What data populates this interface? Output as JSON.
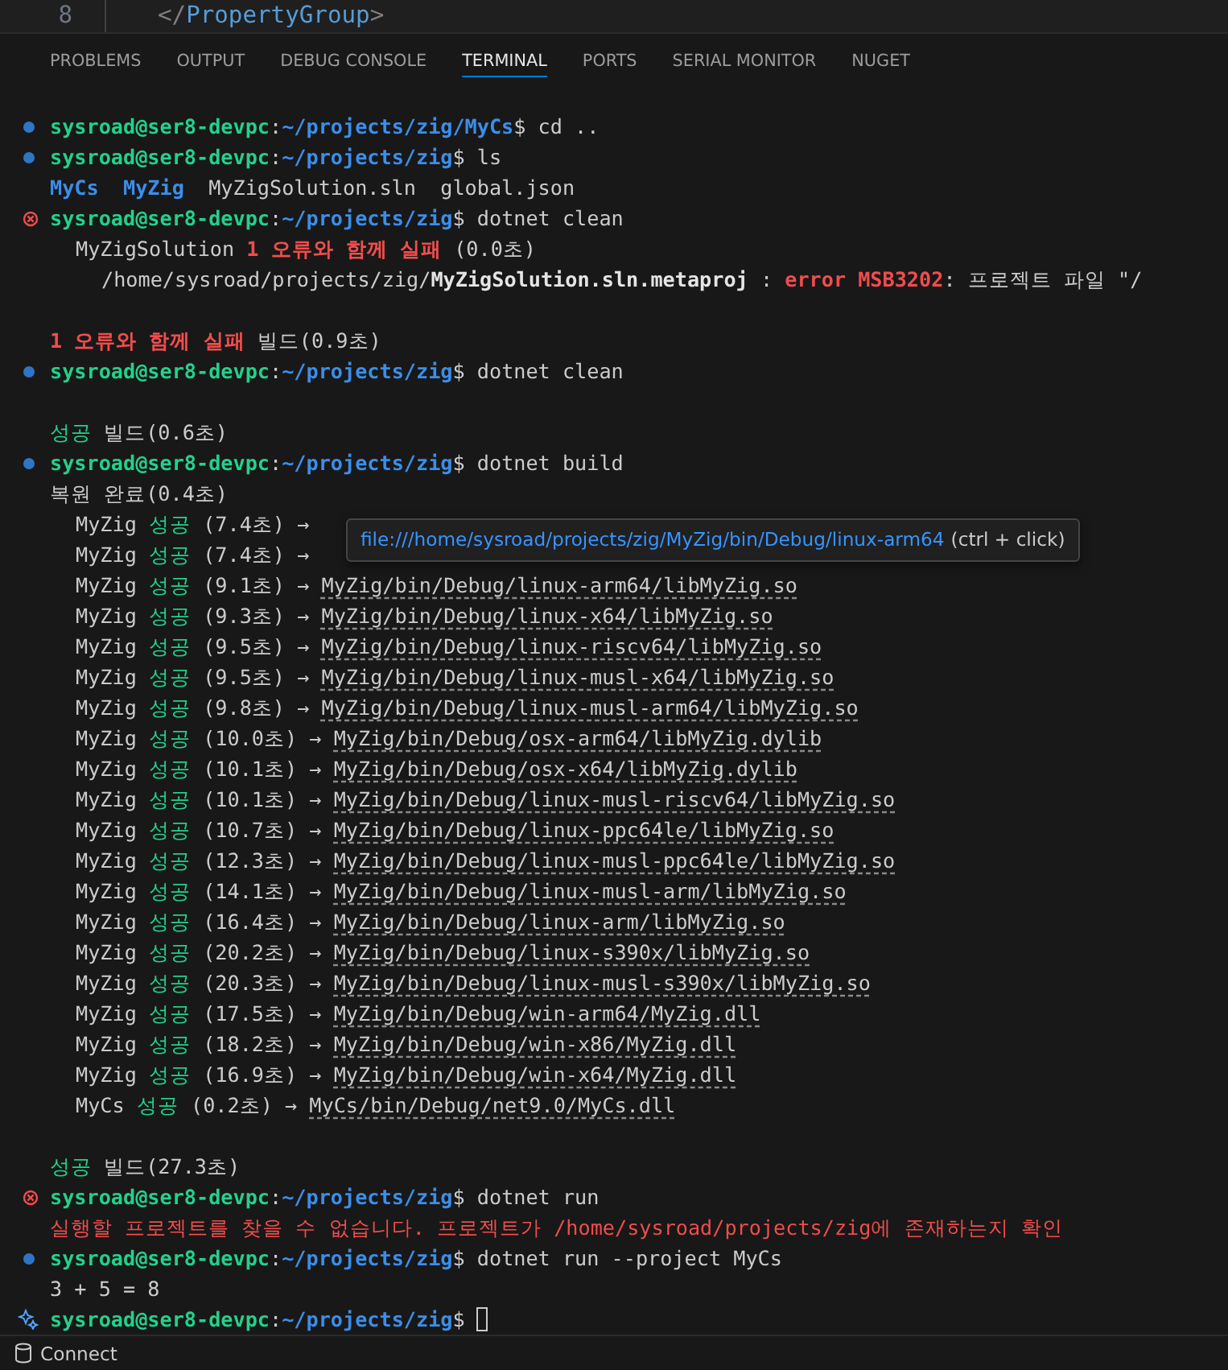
{
  "editor": {
    "line_number": "8",
    "code": [
      {
        "kind": "punct",
        "text": "</"
      },
      {
        "kind": "tag",
        "text": "PropertyGroup"
      },
      {
        "kind": "punct",
        "text": ">"
      }
    ]
  },
  "panel_tabs": [
    {
      "label": "PROBLEMS",
      "selected": false
    },
    {
      "label": "OUTPUT",
      "selected": false
    },
    {
      "label": "DEBUG CONSOLE",
      "selected": false
    },
    {
      "label": "TERMINAL",
      "selected": true
    },
    {
      "label": "PORTS",
      "selected": false
    },
    {
      "label": "SERIAL MONITOR",
      "selected": false
    },
    {
      "label": "NUGET",
      "selected": false
    }
  ],
  "terminal": {
    "lines": [
      {
        "kind": "prompt-success",
        "segments": [
          {
            "kind": "user",
            "text": "sysroad@ser8-devpc"
          },
          {
            "kind": "plain",
            "text": ":"
          },
          {
            "kind": "path",
            "text": "~/projects/zig/MyCs"
          },
          {
            "kind": "plain",
            "text": "$ cd .."
          }
        ]
      },
      {
        "kind": "prompt-success",
        "segments": [
          {
            "kind": "user",
            "text": "sysroad@ser8-devpc"
          },
          {
            "kind": "plain",
            "text": ":"
          },
          {
            "kind": "path",
            "text": "~/projects/zig"
          },
          {
            "kind": "plain",
            "text": "$ ls"
          }
        ]
      },
      {
        "kind": "output",
        "segments": [
          {
            "kind": "dir",
            "text": "MyCs"
          },
          {
            "kind": "dir",
            "text": "MyZig"
          },
          {
            "kind": "plain",
            "text": "MyZigSolution.sln  global.json"
          }
        ]
      },
      {
        "kind": "prompt-error",
        "segments": [
          {
            "kind": "user",
            "text": "sysroad@ser8-devpc"
          },
          {
            "kind": "plain",
            "text": ":"
          },
          {
            "kind": "path",
            "text": "~/projects/zig"
          },
          {
            "kind": "plain",
            "text": "$ dotnet clean"
          }
        ]
      },
      {
        "kind": "indent",
        "segments": [
          {
            "kind": "plain",
            "text": "MyZigSolution "
          },
          {
            "kind": "red-bold",
            "text": "1 오류와 함께 실패"
          },
          {
            "kind": "plain",
            "text": " (0.0초)"
          }
        ]
      },
      {
        "kind": "indent2",
        "segments": [
          {
            "kind": "plain",
            "text": "/home/sysroad/projects/zig/"
          },
          {
            "kind": "bold",
            "text": "MyZigSolution.sln.metaproj"
          },
          {
            "kind": "plain",
            "text": " : "
          },
          {
            "kind": "red-bold",
            "text": "error MSB3202"
          },
          {
            "kind": "plain",
            "text": ": 프로젝트 파일 \"/"
          }
        ]
      },
      {
        "kind": "blank"
      },
      {
        "kind": "output",
        "segments": [
          {
            "kind": "red-bold",
            "text": "1 오류와 함께 실패"
          },
          {
            "kind": "plain",
            "text": " 빌드(0.9초)"
          }
        ]
      },
      {
        "kind": "prompt-success",
        "segments": [
          {
            "kind": "user",
            "text": "sysroad@ser8-devpc"
          },
          {
            "kind": "plain",
            "text": ":"
          },
          {
            "kind": "path",
            "text": "~/projects/zig"
          },
          {
            "kind": "plain",
            "text": "$ dotnet clean"
          }
        ]
      },
      {
        "kind": "blank"
      },
      {
        "kind": "output",
        "segments": [
          {
            "kind": "green",
            "text": "성공"
          },
          {
            "kind": "plain",
            "text": " 빌드(0.6초)"
          }
        ]
      },
      {
        "kind": "prompt-success",
        "segments": [
          {
            "kind": "user",
            "text": "sysroad@ser8-devpc"
          },
          {
            "kind": "plain",
            "text": ":"
          },
          {
            "kind": "path",
            "text": "~/projects/zig"
          },
          {
            "kind": "plain",
            "text": "$ dotnet build"
          }
        ]
      },
      {
        "kind": "output",
        "segments": [
          {
            "kind": "plain",
            "text": "복원 완료(0.4초)"
          }
        ]
      },
      {
        "kind": "indent",
        "segments": [
          {
            "kind": "plain",
            "text": "MyZig "
          },
          {
            "kind": "green",
            "text": "성공"
          },
          {
            "kind": "plain",
            "text": " (7.4초) →"
          }
        ]
      },
      {
        "kind": "indent",
        "segments": [
          {
            "kind": "plain",
            "text": "MyZig "
          },
          {
            "kind": "green",
            "text": "성공"
          },
          {
            "kind": "plain",
            "text": " (7.4초) →"
          }
        ]
      },
      {
        "kind": "indent",
        "segments": [
          {
            "kind": "plain",
            "text": "MyZig "
          },
          {
            "kind": "green",
            "text": "성공"
          },
          {
            "kind": "plain",
            "text": " (9.1초) → "
          },
          {
            "kind": "link",
            "text": "MyZig/bin/Debug/linux-arm64/libMyZig.so"
          }
        ]
      },
      {
        "kind": "indent",
        "segments": [
          {
            "kind": "plain",
            "text": "MyZig "
          },
          {
            "kind": "green",
            "text": "성공"
          },
          {
            "kind": "plain",
            "text": " (9.3초) → "
          },
          {
            "kind": "link",
            "text": "MyZig/bin/Debug/linux-x64/libMyZig.so"
          }
        ]
      },
      {
        "kind": "indent",
        "segments": [
          {
            "kind": "plain",
            "text": "MyZig "
          },
          {
            "kind": "green",
            "text": "성공"
          },
          {
            "kind": "plain",
            "text": " (9.5초) → "
          },
          {
            "kind": "link",
            "text": "MyZig/bin/Debug/linux-riscv64/libMyZig.so"
          }
        ]
      },
      {
        "kind": "indent",
        "segments": [
          {
            "kind": "plain",
            "text": "MyZig "
          },
          {
            "kind": "green",
            "text": "성공"
          },
          {
            "kind": "plain",
            "text": " (9.5초) → "
          },
          {
            "kind": "link",
            "text": "MyZig/bin/Debug/linux-musl-x64/libMyZig.so"
          }
        ]
      },
      {
        "kind": "indent",
        "segments": [
          {
            "kind": "plain",
            "text": "MyZig "
          },
          {
            "kind": "green",
            "text": "성공"
          },
          {
            "kind": "plain",
            "text": " (9.8초) → "
          },
          {
            "kind": "link",
            "text": "MyZig/bin/Debug/linux-musl-arm64/libMyZig.so"
          }
        ]
      },
      {
        "kind": "indent",
        "segments": [
          {
            "kind": "plain",
            "text": "MyZig "
          },
          {
            "kind": "green",
            "text": "성공"
          },
          {
            "kind": "plain",
            "text": " (10.0초) → "
          },
          {
            "kind": "link",
            "text": "MyZig/bin/Debug/osx-arm64/libMyZig.dylib"
          }
        ]
      },
      {
        "kind": "indent",
        "segments": [
          {
            "kind": "plain",
            "text": "MyZig "
          },
          {
            "kind": "green",
            "text": "성공"
          },
          {
            "kind": "plain",
            "text": " (10.1초) → "
          },
          {
            "kind": "link",
            "text": "MyZig/bin/Debug/osx-x64/libMyZig.dylib"
          }
        ]
      },
      {
        "kind": "indent",
        "segments": [
          {
            "kind": "plain",
            "text": "MyZig "
          },
          {
            "kind": "green",
            "text": "성공"
          },
          {
            "kind": "plain",
            "text": " (10.1초) → "
          },
          {
            "kind": "link",
            "text": "MyZig/bin/Debug/linux-musl-riscv64/libMyZig.so"
          }
        ]
      },
      {
        "kind": "indent",
        "segments": [
          {
            "kind": "plain",
            "text": "MyZig "
          },
          {
            "kind": "green",
            "text": "성공"
          },
          {
            "kind": "plain",
            "text": " (10.7초) → "
          },
          {
            "kind": "link",
            "text": "MyZig/bin/Debug/linux-ppc64le/libMyZig.so"
          }
        ]
      },
      {
        "kind": "indent",
        "segments": [
          {
            "kind": "plain",
            "text": "MyZig "
          },
          {
            "kind": "green",
            "text": "성공"
          },
          {
            "kind": "plain",
            "text": " (12.3초) → "
          },
          {
            "kind": "link",
            "text": "MyZig/bin/Debug/linux-musl-ppc64le/libMyZig.so"
          }
        ]
      },
      {
        "kind": "indent",
        "segments": [
          {
            "kind": "plain",
            "text": "MyZig "
          },
          {
            "kind": "green",
            "text": "성공"
          },
          {
            "kind": "plain",
            "text": " (14.1초) → "
          },
          {
            "kind": "link",
            "text": "MyZig/bin/Debug/linux-musl-arm/libMyZig.so"
          }
        ]
      },
      {
        "kind": "indent",
        "segments": [
          {
            "kind": "plain",
            "text": "MyZig "
          },
          {
            "kind": "green",
            "text": "성공"
          },
          {
            "kind": "plain",
            "text": " (16.4초) → "
          },
          {
            "kind": "link",
            "text": "MyZig/bin/Debug/linux-arm/libMyZig.so"
          }
        ]
      },
      {
        "kind": "indent",
        "segments": [
          {
            "kind": "plain",
            "text": "MyZig "
          },
          {
            "kind": "green",
            "text": "성공"
          },
          {
            "kind": "plain",
            "text": " (20.2초) → "
          },
          {
            "kind": "link",
            "text": "MyZig/bin/Debug/linux-s390x/libMyZig.so"
          }
        ]
      },
      {
        "kind": "indent",
        "segments": [
          {
            "kind": "plain",
            "text": "MyZig "
          },
          {
            "kind": "green",
            "text": "성공"
          },
          {
            "kind": "plain",
            "text": " (20.3초) → "
          },
          {
            "kind": "link",
            "text": "MyZig/bin/Debug/linux-musl-s390x/libMyZig.so"
          }
        ]
      },
      {
        "kind": "indent",
        "segments": [
          {
            "kind": "plain",
            "text": "MyZig "
          },
          {
            "kind": "green",
            "text": "성공"
          },
          {
            "kind": "plain",
            "text": " (17.5초) → "
          },
          {
            "kind": "link",
            "text": "MyZig/bin/Debug/win-arm64/MyZig.dll"
          }
        ]
      },
      {
        "kind": "indent",
        "segments": [
          {
            "kind": "plain",
            "text": "MyZig "
          },
          {
            "kind": "green",
            "text": "성공"
          },
          {
            "kind": "plain",
            "text": " (18.2초) → "
          },
          {
            "kind": "link",
            "text": "MyZig/bin/Debug/win-x86/MyZig.dll"
          }
        ]
      },
      {
        "kind": "indent",
        "segments": [
          {
            "kind": "plain",
            "text": "MyZig "
          },
          {
            "kind": "green",
            "text": "성공"
          },
          {
            "kind": "plain",
            "text": " (16.9초) → "
          },
          {
            "kind": "link",
            "text": "MyZig/bin/Debug/win-x64/MyZig.dll"
          }
        ]
      },
      {
        "kind": "indent",
        "segments": [
          {
            "kind": "plain",
            "text": "MyCs "
          },
          {
            "kind": "green",
            "text": "성공"
          },
          {
            "kind": "plain",
            "text": " (0.2초) → "
          },
          {
            "kind": "link",
            "text": "MyCs/bin/Debug/net9.0/MyCs.dll"
          }
        ]
      },
      {
        "kind": "blank"
      },
      {
        "kind": "output",
        "segments": [
          {
            "kind": "green",
            "text": "성공"
          },
          {
            "kind": "plain",
            "text": " 빌드(27.3초)"
          }
        ]
      },
      {
        "kind": "prompt-error",
        "segments": [
          {
            "kind": "user",
            "text": "sysroad@ser8-devpc"
          },
          {
            "kind": "plain",
            "text": ":"
          },
          {
            "kind": "path",
            "text": "~/projects/zig"
          },
          {
            "kind": "plain",
            "text": "$ dotnet run"
          }
        ]
      },
      {
        "kind": "output",
        "segments": [
          {
            "kind": "red",
            "text": "실행할 프로젝트를 찾을 수 없습니다. 프로젝트가 /home/sysroad/projects/zig에 존재하는지 확인"
          }
        ]
      },
      {
        "kind": "prompt-success",
        "segments": [
          {
            "kind": "user",
            "text": "sysroad@ser8-devpc"
          },
          {
            "kind": "plain",
            "text": ":"
          },
          {
            "kind": "path",
            "text": "~/projects/zig"
          },
          {
            "kind": "plain",
            "text": "$ dotnet run --project MyCs"
          }
        ]
      },
      {
        "kind": "output",
        "segments": [
          {
            "kind": "plain",
            "text": "3 + 5 = 8"
          }
        ]
      },
      {
        "kind": "prompt-active",
        "cursor": true,
        "segments": [
          {
            "kind": "user",
            "text": "sysroad@ser8-devpc"
          },
          {
            "kind": "plain",
            "text": ":"
          },
          {
            "kind": "path",
            "text": "~/projects/zig"
          },
          {
            "kind": "plain",
            "text": "$"
          }
        ]
      }
    ],
    "tooltip": {
      "link": "file:///home/sysroad/projects/zig/MyZig/bin/Debug/linux-arm64",
      "hint": "(ctrl + click)"
    }
  },
  "status_bar": {
    "label": "Connect"
  }
}
